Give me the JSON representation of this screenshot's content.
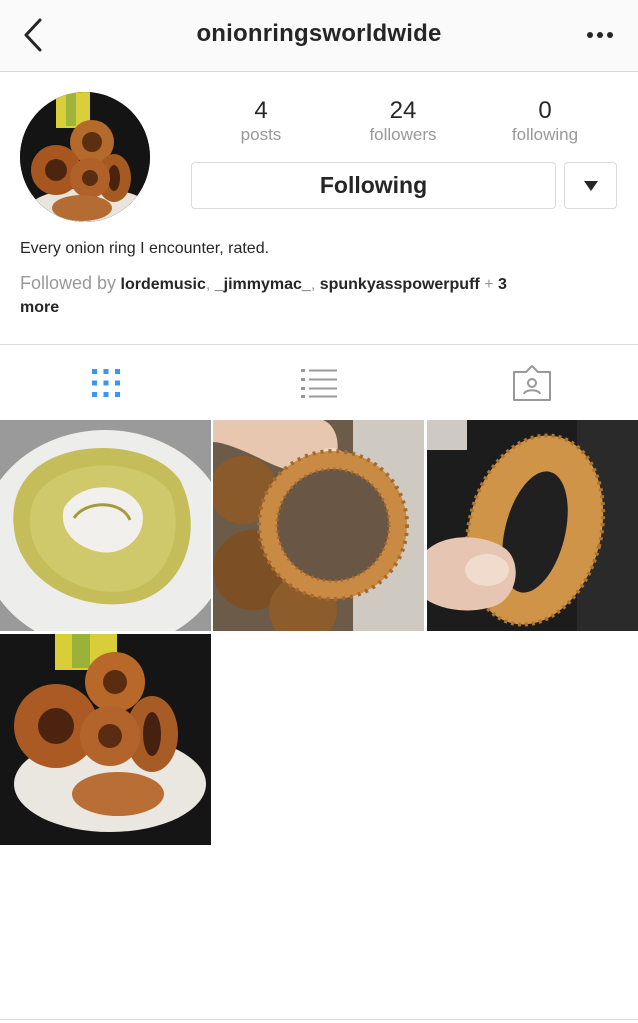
{
  "header": {
    "title": "onionringsworldwide"
  },
  "stats": {
    "posts": {
      "value": "4",
      "label": "posts"
    },
    "followers": {
      "value": "24",
      "label": "followers"
    },
    "following": {
      "value": "0",
      "label": "following"
    }
  },
  "actions": {
    "follow_label": "Following"
  },
  "bio": {
    "text": "Every onion ring I encounter, rated.",
    "followed_by_prefix": "Followed by",
    "followers": [
      "lordemusic",
      "_jimmymac_",
      "spunkyasspowerpuff"
    ],
    "more_prefix": "+",
    "more_count": "3",
    "more_label": "more"
  },
  "tabs": [
    {
      "icon": "grid-icon",
      "active": true
    },
    {
      "icon": "list-icon",
      "active": false
    },
    {
      "icon": "tagged-icon",
      "active": false
    }
  ],
  "colors": {
    "active_tab": "#3897f0",
    "inactive_icon": "#999999",
    "text": "#262626",
    "muted": "#999999",
    "border": "#dbdbdb"
  },
  "posts": [
    {
      "subject": "battered onion ring on white plate"
    },
    {
      "subject": "breaded onion ring held in fingers"
    },
    {
      "subject": "crispy onion ring held on dark background"
    },
    {
      "subject": "stack of onion rings on a plate"
    }
  ]
}
